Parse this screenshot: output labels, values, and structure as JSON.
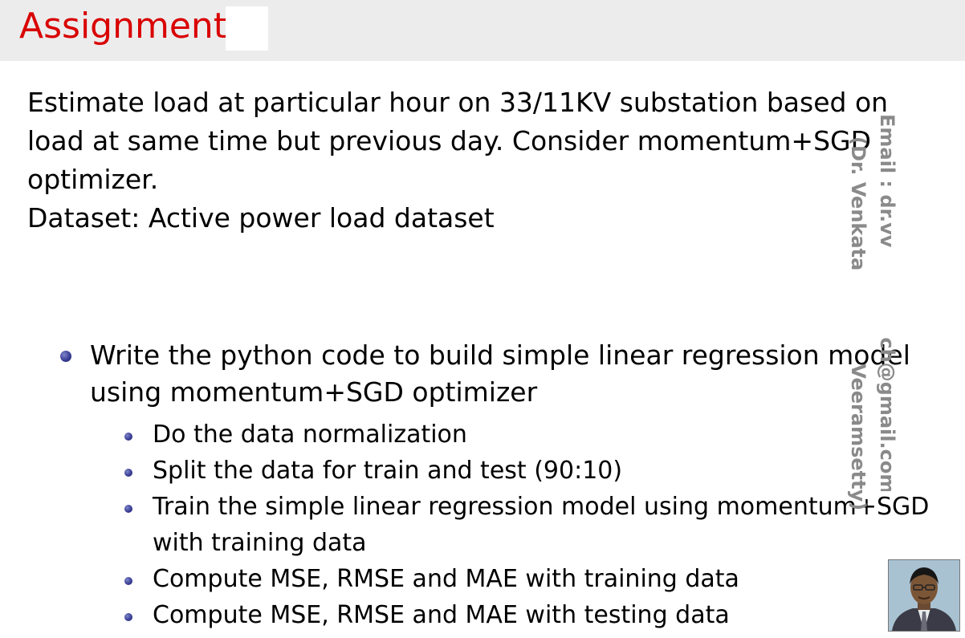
{
  "slide": {
    "title": "Assignment",
    "problem_lines": [
      "Estimate load at particular hour on 33/11KV substation based on",
      "load at same time but previous day.  Consider momentum+SGD",
      "optimizer."
    ],
    "dataset_line": "Dataset:  Active power load dataset",
    "main_bullet_lines": [
      "Write the python code to build simple linear regression model",
      "using momentum+SGD optimizer"
    ],
    "sub_bullets": [
      "Do the data normalization",
      "Split the data for train and test (90:10)",
      "Train the simple linear regression model using momentum+SGD",
      "with training data",
      "Compute MSE, RMSE and MAE with training data",
      "Compute MSE, RMSE and MAE with testing data"
    ],
    "watermark": {
      "email_part1": "Email : dr.vv",
      "email_part2": "ch@gmail.com",
      "name_part1": "(Dr. Venkata",
      "name_part2": "Veeramsetty)"
    }
  }
}
